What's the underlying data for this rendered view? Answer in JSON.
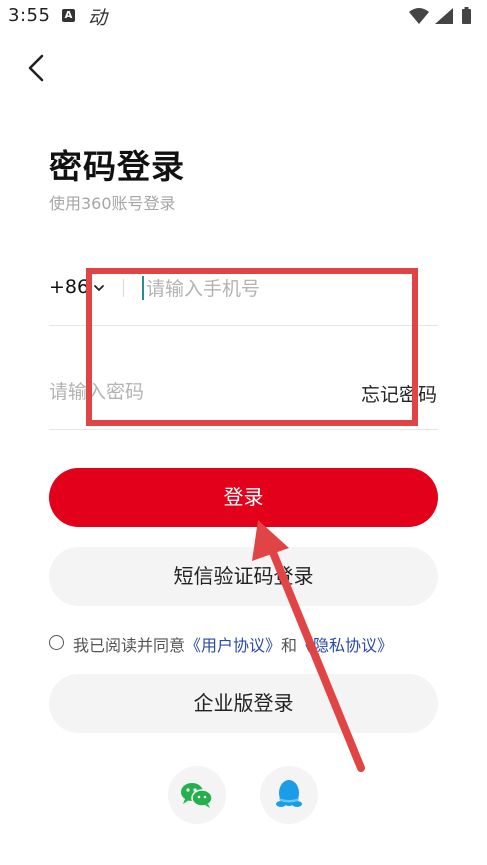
{
  "status_bar": {
    "time": "3:55",
    "indicator_a": "A",
    "indicator_dong": "动"
  },
  "page": {
    "title": "密码登录",
    "subtitle": "使用360账号登录"
  },
  "phone": {
    "country_code": "+86",
    "placeholder": "请输入手机号"
  },
  "password": {
    "placeholder": "请输入密码",
    "forgot_label": "忘记密码"
  },
  "buttons": {
    "login": "登录",
    "sms_login": "短信验证码登录",
    "enterprise_login": "企业版登录"
  },
  "agreement": {
    "prefix": "我已阅读并同意",
    "user_agreement": "《用户协议》",
    "conjunction": "和",
    "privacy_agreement": "《隐私协议》"
  },
  "colors": {
    "brand_red": "#e2001a",
    "link_blue": "#2a4aa8",
    "annotation_red": "#e04444"
  },
  "icons": [
    "back-icon",
    "chevron-down-icon",
    "wechat-icon",
    "qq-icon",
    "wifi-icon",
    "signal-icon",
    "battery-icon"
  ]
}
